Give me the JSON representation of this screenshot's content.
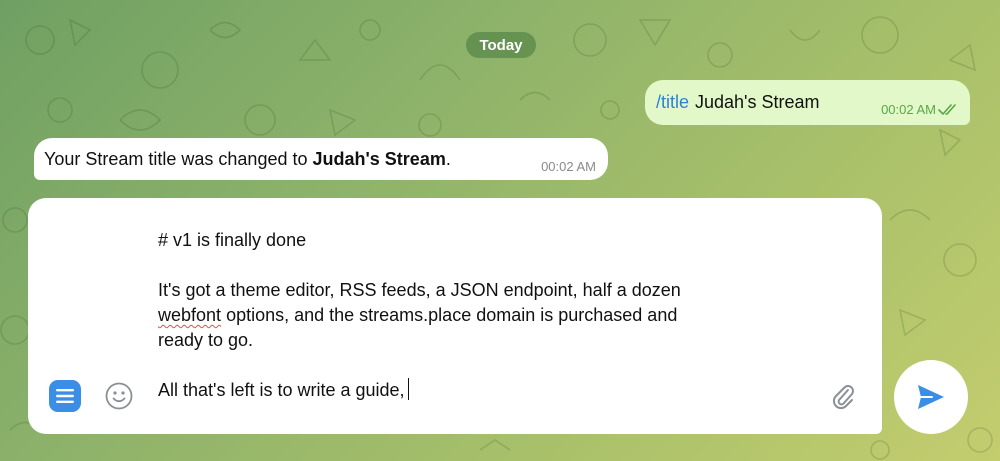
{
  "chat": {
    "date_label": "Today",
    "messages": [
      {
        "direction": "outgoing",
        "command": "/title",
        "text": "Judah's Stream",
        "time": "00:02 AM",
        "status": "read"
      },
      {
        "direction": "incoming",
        "text_prefix": "Your Stream title was changed to ",
        "text_bold": "Judah's Stream",
        "text_suffix": ".",
        "time": "00:02 AM"
      }
    ]
  },
  "composer": {
    "lines": [
      "# v1 is finally done",
      "",
      "It's got a theme editor, RSS feeds, a JSON endpoint, half a dozen",
      "options, and the streams.place domain is purchased and",
      "ready to go.",
      "",
      "All that's left is to write a guide,"
    ],
    "misspelled_word": "webfont",
    "icons": {
      "menu": "menu-icon",
      "emoji": "smiley-icon",
      "attach": "paperclip-icon",
      "send": "send-icon"
    }
  },
  "colors": {
    "accent": "#3a8ee6",
    "outgoing_bubble": "#e2f8c9",
    "outgoing_time": "#5ba64b",
    "command_link": "#2d82d6"
  }
}
